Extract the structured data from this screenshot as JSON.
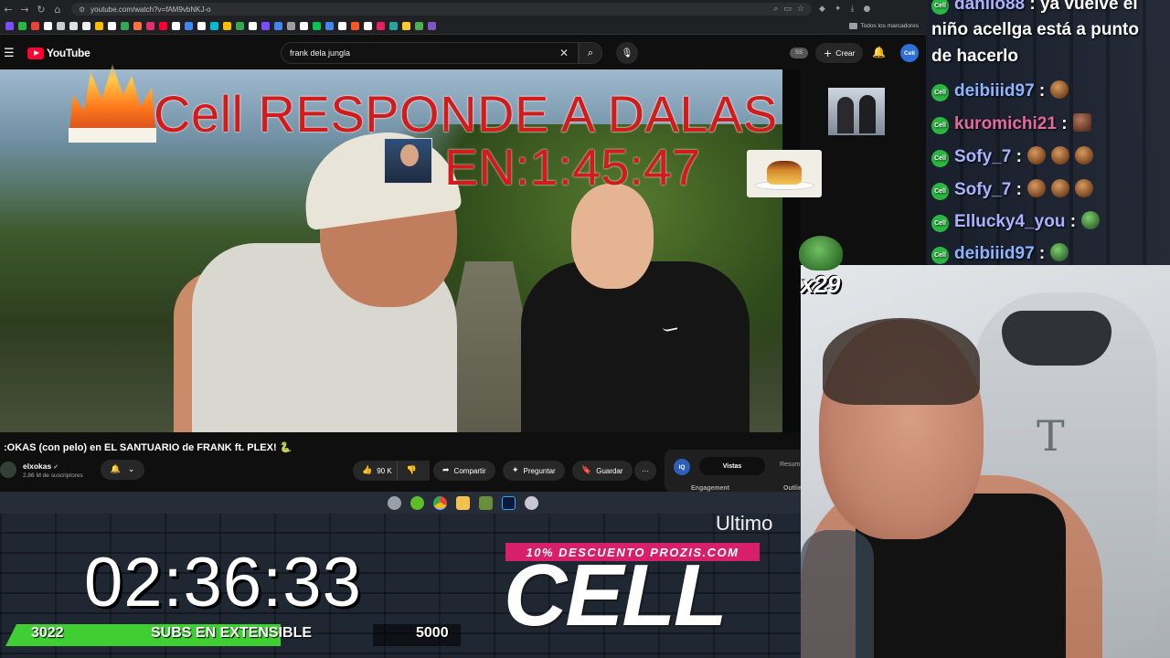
{
  "browser": {
    "url": "youtube.com/watch?v=fAM9vbNKJ-o",
    "bookmarks_folder": "Todos los marcadores"
  },
  "youtube": {
    "logo_text": "YouTube",
    "search_value": "frank dela jungla",
    "ss_badge": "SS",
    "create_label": "Crear",
    "avatar_text": "Cell",
    "video_title": ":OKAS (con pelo) en EL SANTUARIO de FRANK ft. PLEX! 🐍",
    "channel_name": "elxokas",
    "channel_subs": "2,86 M de suscriptores",
    "like_count": "90 K",
    "share_label": "Compartir",
    "ask_label": "Preguntar",
    "save_label": "Guardar",
    "more_label": "···",
    "side_tabs": {
      "iq": "IQ",
      "active": "Vistas",
      "other": "Resum",
      "engagement": "Engagement",
      "outlier": "Outlie"
    }
  },
  "video_overlay": {
    "title": "Cell RESPONDE A DALAS",
    "countdown": "EN:1:45:47"
  },
  "chat": {
    "messages": [
      {
        "user": "danilo88",
        "text": ": ya vuelve el"
      },
      {
        "user": "",
        "text": "niño acellga está a punto"
      },
      {
        "user": "",
        "text": "de hacerlo"
      },
      {
        "user": "deibiiid97",
        "text": ":"
      },
      {
        "user": "kuromichi21",
        "text": ":"
      },
      {
        "user": "Sofy_7",
        "text": ":"
      },
      {
        "user": "Sofy_7",
        "text": ":"
      },
      {
        "user": "Ellucky4_you",
        "text": ":"
      },
      {
        "user": "deibiiid97",
        "text": ":"
      }
    ]
  },
  "emote_combo": "x29",
  "stream_overlay": {
    "ultimo": "Ultimo",
    "timer": "02:36:33",
    "subs_current": "3022",
    "subs_label": "SUBS EN EXTENSIBLE",
    "subs_goal": "5000",
    "subs_progress": 0.6044,
    "promo": "10% DESCUENTO PROZIS.COM",
    "brand": "CELL"
  },
  "colors": {
    "youtube_red": "#ff0033",
    "overlay_title": "#d21b1b",
    "subs_bar": "#3fcf33",
    "promo_pink": "#d71f6a",
    "chat_badge": "#2bb641"
  }
}
